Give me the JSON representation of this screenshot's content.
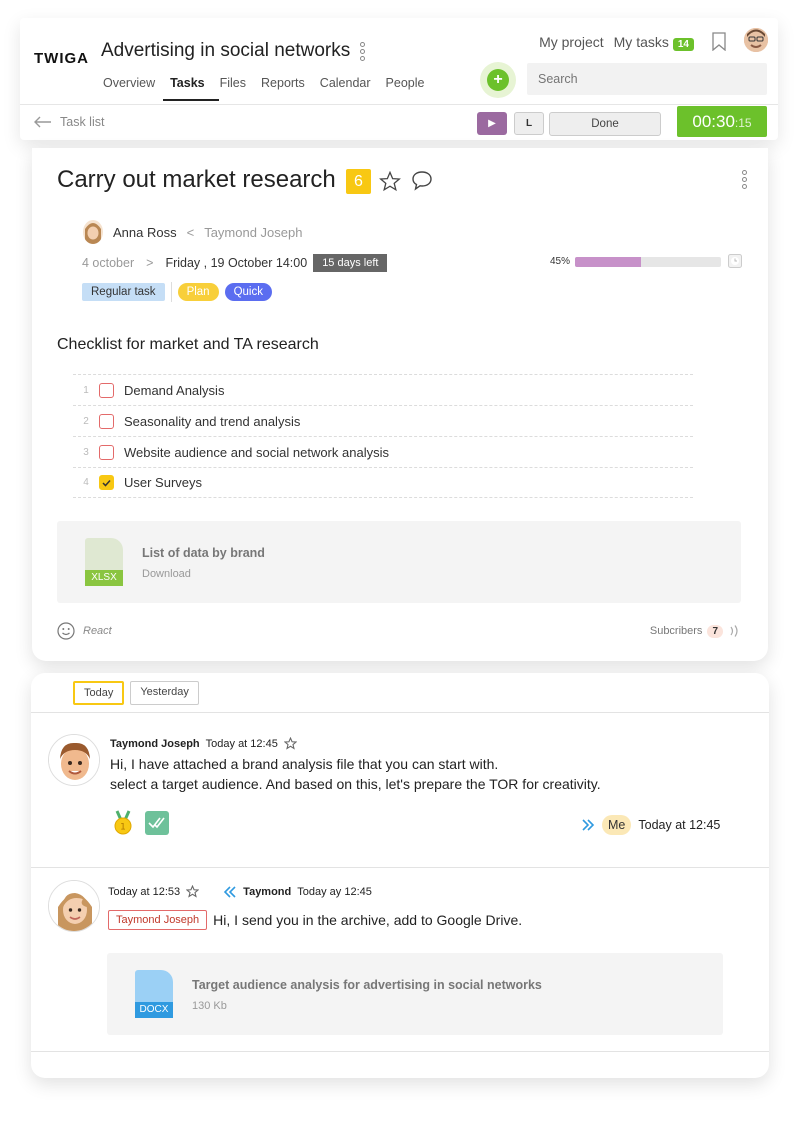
{
  "header": {
    "logo": "TWIGA",
    "project_title": "Advertising in social networks",
    "tabs": [
      {
        "label": "Overview",
        "active": false
      },
      {
        "label": "Tasks",
        "active": true
      },
      {
        "label": "Files",
        "active": false
      },
      {
        "label": "Reports",
        "active": false
      },
      {
        "label": "Calendar",
        "active": false
      },
      {
        "label": "People",
        "active": false
      }
    ],
    "my_project": "My project",
    "my_tasks": "My tasks",
    "my_tasks_count": "14",
    "search_placeholder": "Search",
    "add_symbol": "+"
  },
  "subbar": {
    "back_label": "Task list",
    "play_symbol": "▶",
    "l_label": "L",
    "done_label": "Done",
    "timer_main": "00:30",
    "timer_sec": ":15"
  },
  "task": {
    "title": "Carry out market research",
    "number": "6",
    "assignee": "Anna Ross",
    "arrow": "<",
    "creator": "Taymond Joseph",
    "start_date": "4 october",
    "date_arrow": ">",
    "due_date": "Friday , 19 October 14:00",
    "days_left": "15 days left",
    "progress_label": "45%",
    "progress_value": 0.45,
    "tags": [
      {
        "label": "Regular task"
      },
      {
        "label": "Plan",
        "color": "#f8cf3a"
      },
      {
        "label": "Quick",
        "color": "#5b6df0"
      }
    ],
    "checklist_title": "Checklist for market and TA research",
    "checklist": [
      {
        "n": "1",
        "label": "Demand Analysis",
        "done": false
      },
      {
        "n": "2",
        "label": "Seasonality and trend analysis",
        "done": false
      },
      {
        "n": "3",
        "label": "Website audience and social network analysis",
        "done": false
      },
      {
        "n": "4",
        "label": "User Surveys",
        "done": true
      }
    ],
    "attachment": {
      "type": "XLSX",
      "name": "List of data by brand",
      "sub": "Download",
      "color": "#8ac540"
    },
    "react_label": "React",
    "subscribers_label": "Subcribers",
    "subscribers_count": "7"
  },
  "chat": {
    "day_tabs": [
      {
        "label": "Today",
        "active": true
      },
      {
        "label": "Yesterday",
        "active": false
      }
    ],
    "messages": [
      {
        "author": "Taymond Joseph",
        "time": "Today at 12:45",
        "text_line1": "Hi, I have attached a brand analysis file that you can start with.",
        "text_line2": "select a target audience. And based on this, let's prepare the TOR for creativity.",
        "reply_to": "Me",
        "reply_time": "Today at 12:45"
      },
      {
        "time": "Today at 12:53",
        "quoted_author": "Taymond",
        "quoted_time": "Today ay 12:45",
        "mention": "Taymond Joseph",
        "text": "Hi, I send you in the archive, add to Google Drive.",
        "attachment": {
          "type": "DOCX",
          "name": "Target audience analysis for advertising in social networks",
          "sub": "130 Kb",
          "color": "#2f9ae0"
        }
      }
    ]
  },
  "colors": {
    "accent_green": "#6cc12b",
    "accent_yellow": "#f8c813",
    "progress": "#c791c9"
  }
}
